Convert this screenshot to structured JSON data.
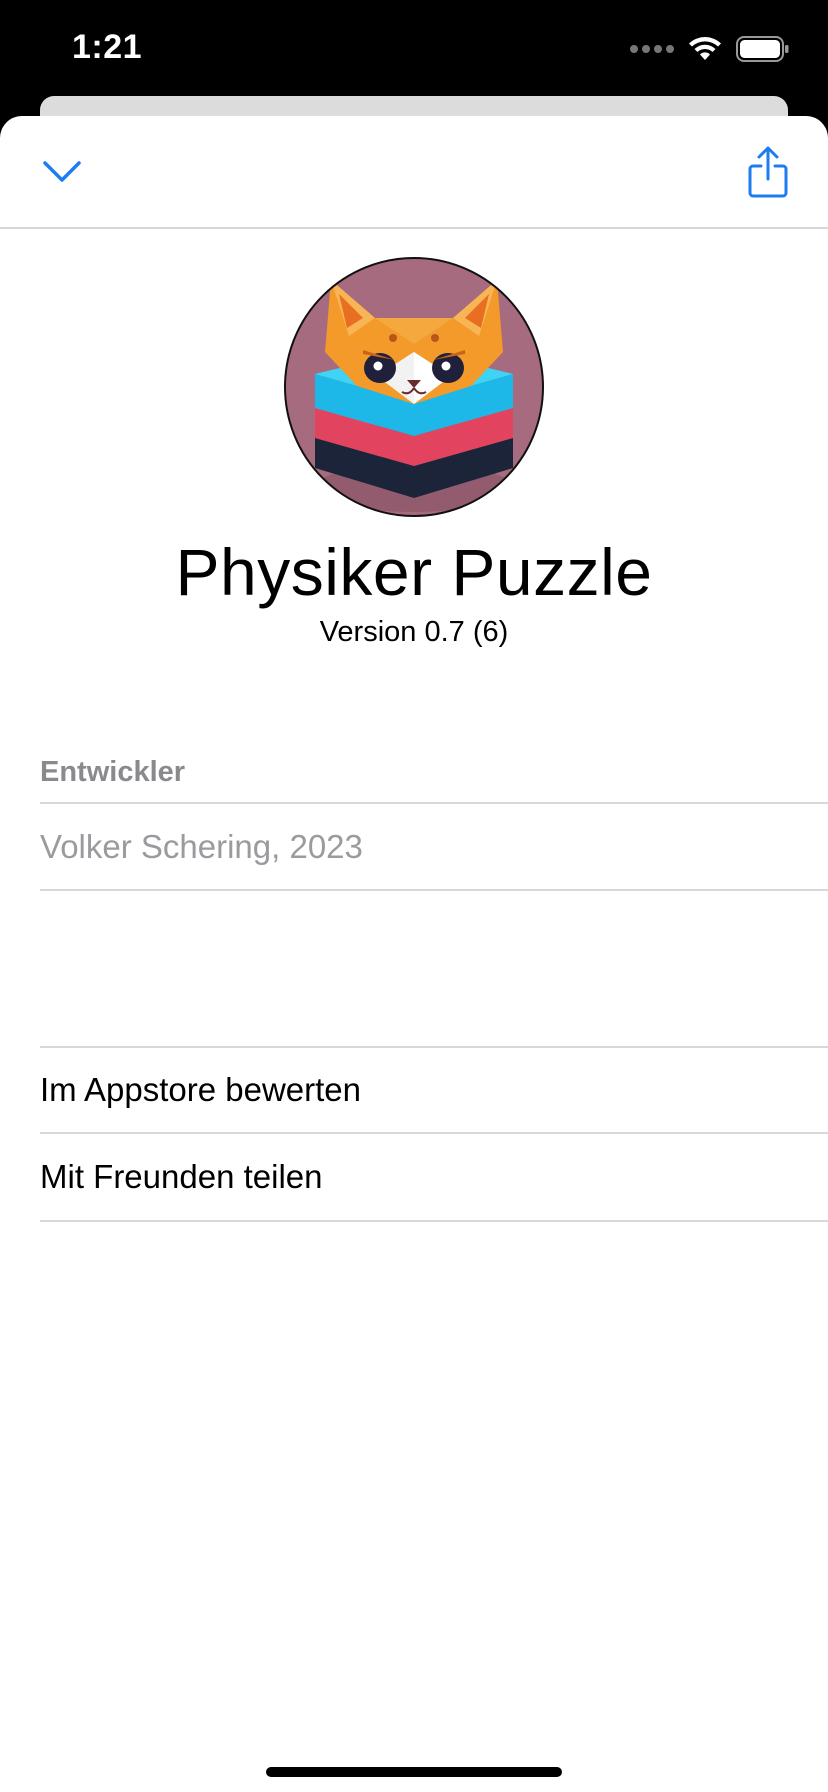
{
  "status_bar": {
    "time": "1:21",
    "icons": [
      "cellular-signal-icon",
      "wifi-icon",
      "battery-icon"
    ]
  },
  "nav": {
    "icons": [
      "chevron-down-icon",
      "share-icon"
    ],
    "accent_color": "#1E7CF2"
  },
  "app": {
    "icon": "app-icon-cat-on-layers",
    "title": "Physiker Puzzle",
    "version": "Version 0.7 (6)"
  },
  "developer_section": {
    "header": "Entwickler",
    "value": "Volker Schering, 2023"
  },
  "actions": [
    {
      "label": "Im Appstore bewerten"
    },
    {
      "label": "Mit Freunden teilen"
    }
  ],
  "colors": {
    "separator": "#D8D8DC",
    "secondary_text": "#8A8A8E",
    "background": "#FFFFFF"
  }
}
